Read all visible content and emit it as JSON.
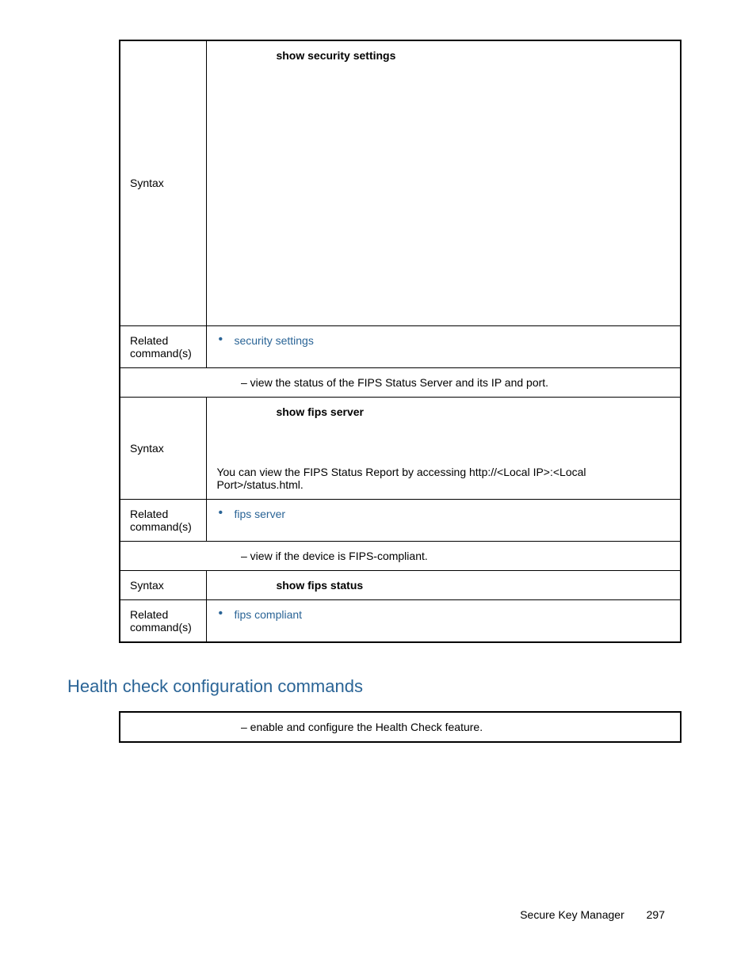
{
  "table1": {
    "rows": [
      {
        "label": "Syntax",
        "command": "show security settings"
      },
      {
        "label": "Related command(s)",
        "link": "security settings"
      }
    ],
    "divider1": "– view the status of the FIPS Status Server and its IP and port.",
    "rows2": [
      {
        "label": "Syntax",
        "command": "show fips server",
        "note": "You can view the FIPS Status Report by accessing http://<Local IP>:<Local Port>/status.html."
      },
      {
        "label": "Related command(s)",
        "link": "fips server"
      }
    ],
    "divider2": "– view if the device is FIPS-compliant.",
    "rows3": [
      {
        "label": "Syntax",
        "command": "show fips status"
      },
      {
        "label": "Related command(s)",
        "link": "fips compliant"
      }
    ]
  },
  "section_heading": "Health check configuration commands",
  "table2": {
    "desc": "– enable and configure the Health Check feature."
  },
  "footer": {
    "title": "Secure Key Manager",
    "page": "297"
  }
}
